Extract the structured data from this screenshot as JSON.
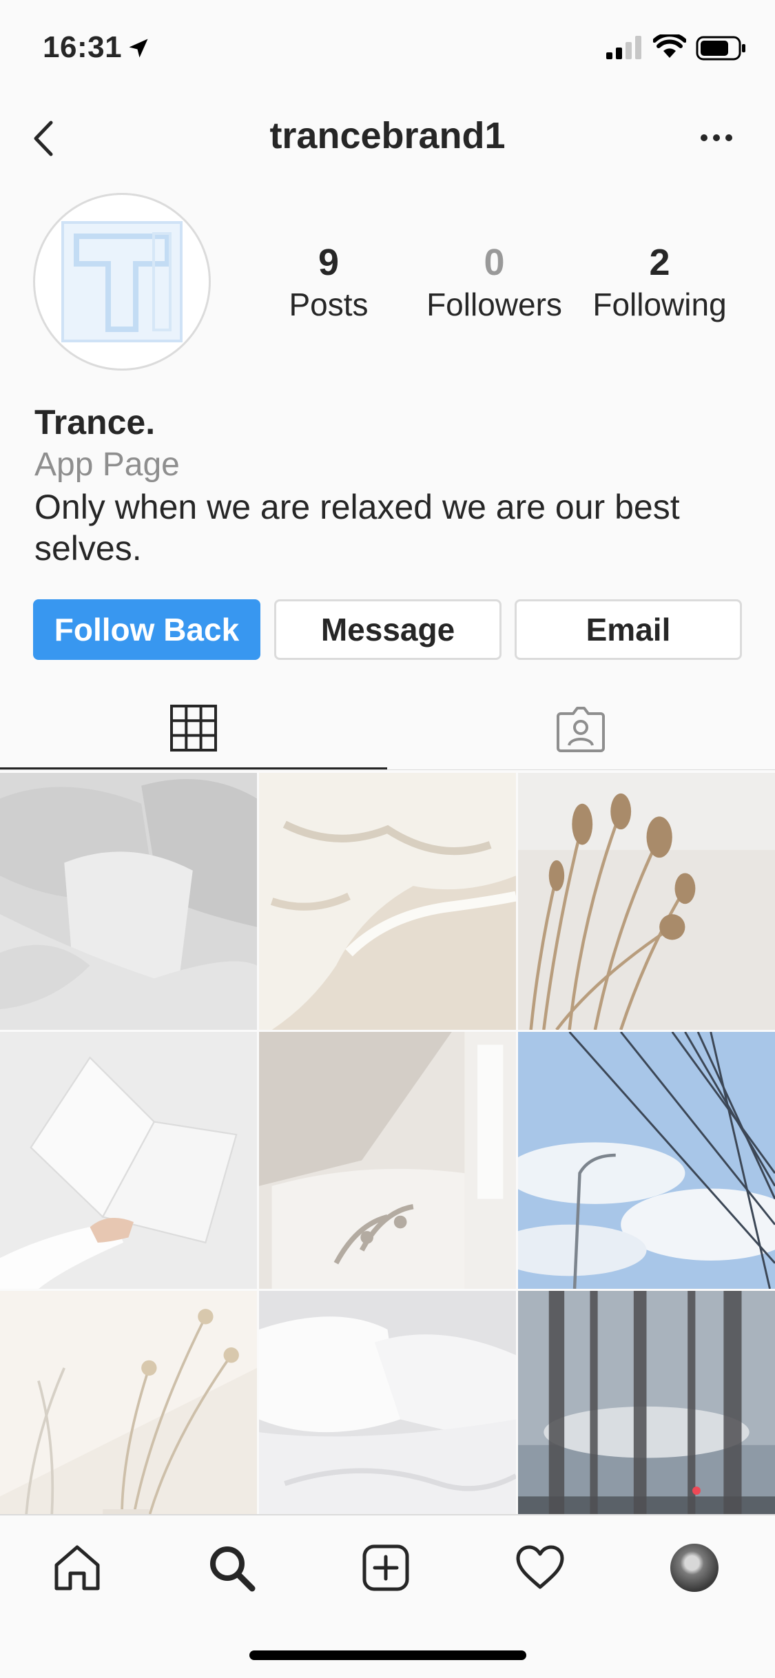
{
  "status_bar": {
    "time": "16:31",
    "icons": [
      "location-arrow-icon",
      "signal-icon",
      "wifi-icon",
      "battery-icon"
    ]
  },
  "header": {
    "username": "trancebrand1",
    "back_icon": "chevron-left-icon",
    "more_icon": "more-dots-icon"
  },
  "profile": {
    "avatar_letter": "T",
    "stats": [
      {
        "value": "9",
        "label": "Posts"
      },
      {
        "value": "0",
        "label": "Followers"
      },
      {
        "value": "2",
        "label": "Following"
      }
    ],
    "name": "Trance.",
    "category": "App Page",
    "bio_line1": "Only when we are relaxed we are our best",
    "bio_line2": "selves."
  },
  "actions": {
    "follow_back": "Follow Back",
    "message": "Message",
    "email": "Email"
  },
  "colors": {
    "accent": "#3897f0",
    "text": "#262626",
    "secondary": "#8e8e8e",
    "border": "#dbdbdb",
    "notification": "#ed4956"
  },
  "tabs": [
    {
      "icon": "grid-icon",
      "active": true
    },
    {
      "icon": "tagged-icon",
      "active": false
    }
  ],
  "posts": [
    {
      "subject": "bed pillows"
    },
    {
      "subject": "sea foam on sand"
    },
    {
      "subject": "dried pampas grass"
    },
    {
      "subject": "hand holding open notebook"
    },
    {
      "subject": "window light on couch"
    },
    {
      "subject": "sky with power lines and lamp post"
    },
    {
      "subject": "dried flowers in vase"
    },
    {
      "subject": "white bed linen"
    },
    {
      "subject": "sheer curtains at window"
    }
  ],
  "tab_bar": [
    "home-icon",
    "search-icon",
    "add-post-icon",
    "heart-icon",
    "profile-avatar"
  ]
}
